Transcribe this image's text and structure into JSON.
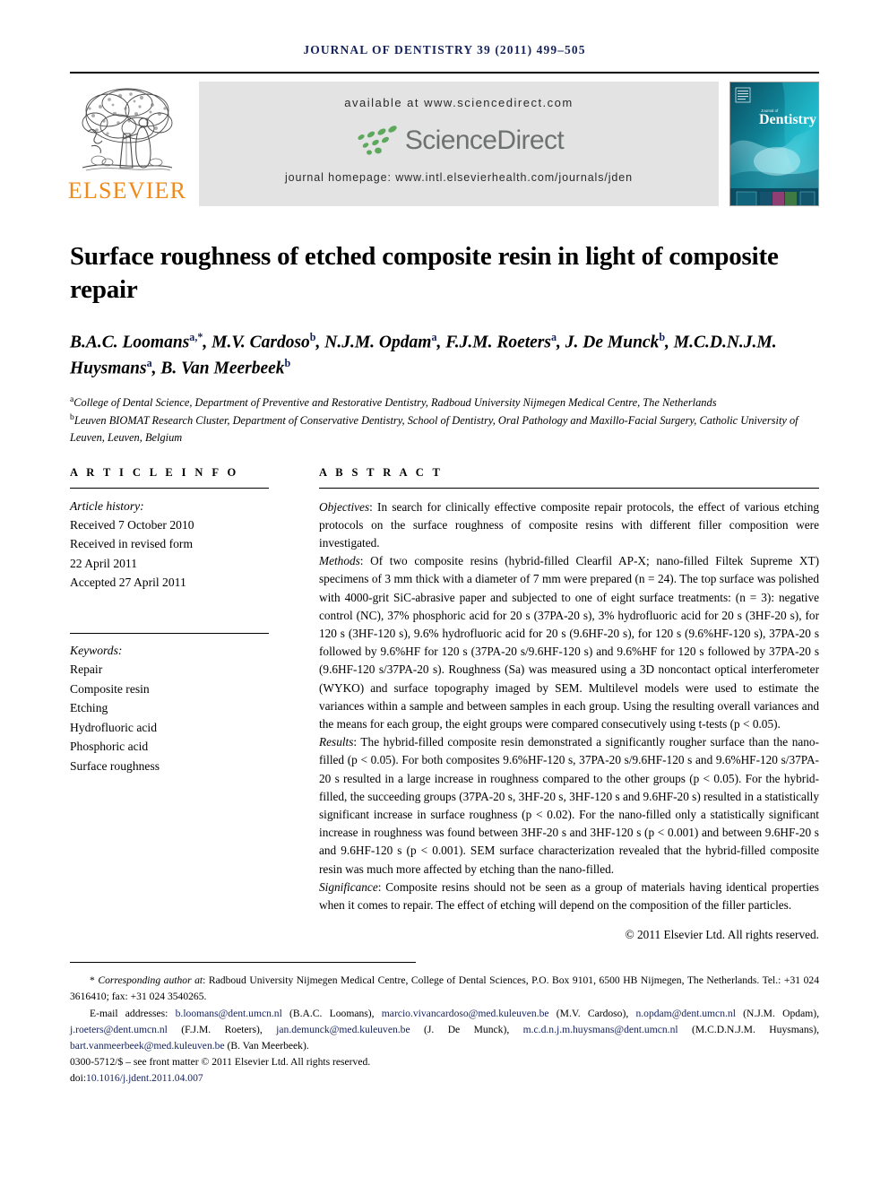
{
  "running_head": "JOURNAL OF DENTISTRY 39 (2011) 499–505",
  "masthead": {
    "publisher_name": "ELSEVIER",
    "available_at": "available at www.sciencedirect.com",
    "sciencedirect_wordmark": "ScienceDirect",
    "journal_homepage": "journal homepage: www.intl.elsevierhealth.com/journals/jden",
    "cover_title_small": "Journal of",
    "cover_title_main": "Dentistry",
    "colors": {
      "elsevier_orange": "#f08a1b",
      "banner_gray": "#e3e3e3",
      "sciencedirect_green": "#5ea85e",
      "sciencedirect_gray": "#6d7271",
      "cover_teal": "#0d5f70",
      "link_navy": "#14225c"
    }
  },
  "article": {
    "title": "Surface roughness of etched composite resin in light of composite repair",
    "authors_line1": "B.A.C. Loomans",
    "authors_html": "B.A.C. Loomans<sup>a,*</sup>, M.V. Cardoso<sup>b</sup>, N.J.M. Opdam<sup>a</sup>, F.J.M. Roeters<sup>a</sup>, J. De Munck<sup>b</sup>, M.C.D.N.J.M. Huysmans<sup>a</sup>, B. Van Meerbeek<sup>b</sup>",
    "affiliation_a": "College of Dental Science, Department of Preventive and Restorative Dentistry, Radboud University Nijmegen Medical Centre, The Netherlands",
    "affiliation_b": "Leuven BIOMAT Research Cluster, Department of Conservative Dentistry, School of Dentistry, Oral Pathology and Maxillo-Facial Surgery, Catholic University of Leuven, Leuven, Belgium"
  },
  "article_info": {
    "heading": "A R T I C L E   I N F O",
    "history_label": "Article history:",
    "history_lines": [
      "Received 7 October 2010",
      "Received in revised form",
      "22 April 2011",
      "Accepted 27 April 2011"
    ],
    "keywords_label": "Keywords:",
    "keywords": [
      "Repair",
      "Composite resin",
      "Etching",
      "Hydrofluoric acid",
      "Phosphoric acid",
      "Surface roughness"
    ]
  },
  "abstract": {
    "heading": "A B S T R A C T",
    "objectives_label": "Objectives",
    "objectives_text": ": In search for clinically effective composite repair protocols, the effect of various etching protocols on the surface roughness of composite resins with different filler composition were investigated.",
    "methods_label": "Methods",
    "methods_text": ": Of two composite resins (hybrid-filled Clearfil AP-X; nano-filled Filtek Supreme XT) specimens of 3 mm thick with a diameter of 7 mm were prepared (n = 24). The top surface was polished with 4000-grit SiC-abrasive paper and subjected to one of eight surface treatments: (n = 3): negative control (NC), 37% phosphoric acid for 20 s (37PA-20 s), 3% hydrofluoric acid for 20 s (3HF-20 s), for 120 s (3HF-120 s), 9.6% hydrofluoric acid for 20 s (9.6HF-20 s), for 120 s (9.6%HF-120 s), 37PA-20 s followed by 9.6%HF for 120 s (37PA-20 s/9.6HF-120 s) and 9.6%HF for 120 s followed by 37PA-20 s (9.6HF-120 s/37PA-20 s). Roughness (Sa) was measured using a 3D noncontact optical interferometer (WYKO) and surface topography imaged by SEM. Multilevel models were used to estimate the variances within a sample and between samples in each group. Using the resulting overall variances and the means for each group, the eight groups were compared consecutively using t-tests (p < 0.05).",
    "results_label": "Results",
    "results_text": ": The hybrid-filled composite resin demonstrated a significantly rougher surface than the nano-filled (p < 0.05). For both composites 9.6%HF-120 s, 37PA-20 s/9.6HF-120 s and 9.6%HF-120 s/37PA-20 s resulted in a large increase in roughness compared to the other groups (p < 0.05). For the hybrid-filled, the succeeding groups (37PA-20 s, 3HF-20 s, 3HF-120 s and 9.6HF-20 s) resulted in a statistically significant increase in surface roughness (p < 0.02). For the nano-filled only a statistically significant increase in roughness was found between 3HF-20 s and 3HF-120 s (p < 0.001) and between 9.6HF-20 s and 9.6HF-120 s (p < 0.001). SEM surface characterization revealed that the hybrid-filled composite resin was much more affected by etching than the nano-filled.",
    "significance_label": "Significance",
    "significance_text": ": Composite resins should not be seen as a group of materials having identical properties when it comes to repair. The effect of etching will depend on the composition of the filler particles.",
    "copyright": "© 2011 Elsevier Ltd. All rights reserved."
  },
  "footer": {
    "corresponding_marker": "*",
    "corresponding_label": "Corresponding author at",
    "corresponding_text": ": Radboud University Nijmegen Medical Centre, College of Dental Sciences, P.O. Box 9101, 6500 HB Nijmegen, The Netherlands. Tel.: +31 024 3616410; fax: +31 024 3540265.",
    "email_label": "E-mail addresses:",
    "emails": [
      {
        "address": "b.loomans@dent.umcn.nl",
        "owner": "(B.A.C. Loomans),"
      },
      {
        "address": "marcio.vivancardoso@med.kuleuven.be",
        "owner": "(M.V. Cardoso),"
      },
      {
        "address": "n.opdam@dent.umcn.nl",
        "owner": "(N.J.M. Opdam),"
      },
      {
        "address": "j.roeters@dent.umcn.nl",
        "owner": "(F.J.M. Roeters),"
      },
      {
        "address": "jan.demunck@med.kuleuven.be",
        "owner": "(J. De Munck),"
      },
      {
        "address": "m.c.d.n.j.m.huysmans@dent.umcn.nl",
        "owner": "(M.C.D.N.J.M. Huysmans),"
      },
      {
        "address": "bart.vanmeerbeek@med.kuleuven.be",
        "owner": "(B. Van Meerbeek)."
      }
    ],
    "issn_line": "0300-5712/$ – see front matter © 2011 Elsevier Ltd. All rights reserved.",
    "doi_label": "doi:",
    "doi_value": "10.1016/j.jdent.2011.04.007"
  }
}
